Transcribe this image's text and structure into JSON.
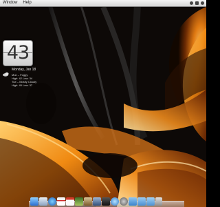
{
  "menubar": {
    "items": [
      "Window",
      "Help"
    ]
  },
  "clock": {
    "value": "43"
  },
  "weather": {
    "date": "Monday, Jan 18",
    "lines": [
      "Mon – Foggy",
      "High: 42 Low: 34",
      "Tue – Mostly Cloudy",
      "High: 45 Low: 37"
    ]
  },
  "dock": {
    "icons": [
      "finder-icon",
      "mail-icon",
      "safari-icon",
      "calendar-icon",
      "ical-date-icon",
      "iphoto-icon",
      "preview-icon",
      "xcode-icon",
      "terminal-icon",
      "itunes-icon",
      "system-preferences-icon",
      "applications-folder-icon",
      "documents-folder-icon",
      "downloads-folder-icon",
      "trash-icon"
    ]
  }
}
